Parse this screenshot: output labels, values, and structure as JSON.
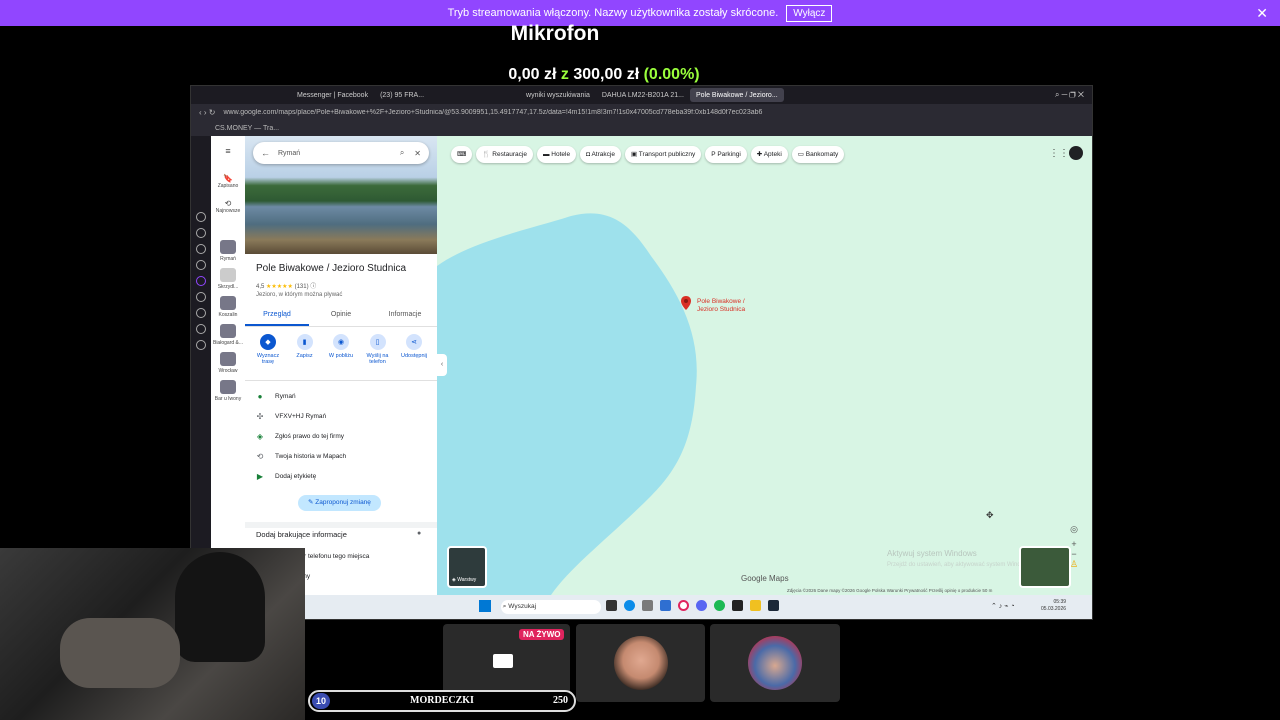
{
  "stream_banner": {
    "message": "Tryb streamowania włączony. Nazwy użytkownika zostały skrócone.",
    "button_label": "Wyłącz",
    "close_glyph": "✕"
  },
  "overlay": {
    "title": "Mikrofon",
    "amount_current": "0,00 zł",
    "separator": "z",
    "amount_goal": "300,00 zł",
    "percent": "(0.00%)"
  },
  "browser": {
    "tabs": [
      "Messenger | Facebook",
      "(23) 95 FRA...",
      "wyniki wyszukiwania",
      "DAHUA LM22-B201A 21...",
      "Pole Biwakowe / Jezioro..."
    ],
    "active_tab_index": 4,
    "url": "www.google.com/maps/place/Pole+Biwakowe+%2F+Jezioro+Studnica/@53.9009951,15.4917747,17.5z/data=!4m15!1m8!3m7!1s0x47005cd778eba39f:0xb148d0f7ec023ab6",
    "bookmark": "CS.MONEY — Tra..."
  },
  "maps": {
    "search_value": "Rymań",
    "rail": {
      "saved": "Zapisano",
      "recent": "Najnowsze",
      "items": [
        "Rymań",
        "Skrzydl...",
        "Koszalin",
        "Białogard &...",
        "Wrocław",
        "Bar u Iwony"
      ]
    },
    "place": {
      "title": "Pole Biwakowe / Jezioro Studnica",
      "rating": "4,5",
      "stars": "★★★★★",
      "reviews": "(131)",
      "description": "Jezioro, w którym można pływać"
    },
    "tabs": [
      "Przegląd",
      "Opinie",
      "Informacje"
    ],
    "actions": [
      "Wyznacz trasę",
      "Zapisz",
      "W pobliżu",
      "Wyślij na telefon",
      "Udostępnij"
    ],
    "info": [
      "Rymań",
      "VFXV+HJ Rymań",
      "Zgłoś prawo do tej firmy",
      "Twoja historia w Mapach",
      "Dodaj etykietę"
    ],
    "suggest_label": "Zaproponuj zmianę",
    "missing_title": "Dodaj brakujące informacje",
    "missing_items": [
      "mer telefonu tego miejsca",
      "dziny"
    ],
    "chips": [
      "Restauracje",
      "Hotele",
      "Atrakcje",
      "Transport publiczny",
      "Parkingi",
      "Apteki",
      "Bankomaty"
    ],
    "pin_label": "Pole Biwakowe / Jezioro Studnica",
    "layers_label": "Warstwy",
    "logo": "Google Maps",
    "activate_title": "Aktywuj system Windows",
    "activate_sub": "Przejdź do ustawień, aby aktywować system Windows.",
    "footer": "Zdjęcia ©2026 Dane mapy ©2026 Google   Polska   Warunki   Prywatność   Prześlij opinię o produkcie   50 m",
    "water_color": "#9ee1ec",
    "land_color": "#d8f5e4"
  },
  "taskbar": {
    "search_placeholder": "Wyszukaj",
    "time": "05:39",
    "date": "05.03.2026"
  },
  "stream": {
    "live_badge": "NA ŻYWO",
    "level": "10",
    "name": "MORDECZKI",
    "count": "250"
  }
}
